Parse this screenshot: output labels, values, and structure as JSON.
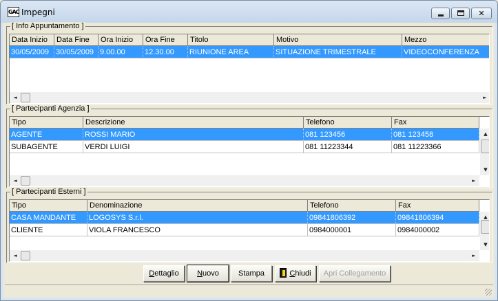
{
  "window": {
    "title": "Impegni",
    "app_icon_text": "GAC",
    "controls": {
      "minimize": "minimize-icon",
      "maximize": "maximize-icon",
      "close": "close-icon",
      "close_glyph": "✕"
    }
  },
  "appuntamento": {
    "caption": "[ Info Appuntamento ]",
    "columns": [
      "Data Inizio",
      "Data Fine",
      "Ora Inizio",
      "Ora Fine",
      "Titolo",
      "Motivo",
      "Mezzo"
    ],
    "rows": [
      [
        "30/05/2009",
        "30/05/2009",
        "9.00.00",
        "12.30.00",
        "RIUNIONE AREA",
        "SITUAZIONE TRIMESTRALE",
        "VIDEOCONFERENZA"
      ]
    ],
    "selected_row": 0
  },
  "agenzia": {
    "caption": "[ Partecipanti Agenzia ]",
    "columns": [
      "Tipo",
      "Descrizione",
      "Telefono",
      "Fax"
    ],
    "rows": [
      [
        "AGENTE",
        "ROSSI MARIO",
        "081 123456",
        "081 123458"
      ],
      [
        "SUBAGENTE",
        "VERDI LUIGI",
        "081 11223344",
        "081 11223366"
      ]
    ],
    "selected_row": 0
  },
  "esterni": {
    "caption": "[ Partecipanti Esterni ]",
    "columns": [
      "Tipo",
      "Denominazione",
      "Telefono",
      "Fax"
    ],
    "rows": [
      [
        "CASA MANDANTE",
        "LOGOSYS S.r.l.",
        "09841806392",
        "09841806394"
      ],
      [
        "CLIENTE",
        "VIOLA FRANCESCO",
        "0984000001",
        "0984000002"
      ]
    ],
    "selected_row": 0
  },
  "buttons": {
    "dettaglio": {
      "mnemonic": "D",
      "rest": "ettaglio"
    },
    "nuovo": {
      "mnemonic": "N",
      "rest": "uovo"
    },
    "stampa": {
      "label": "Stampa"
    },
    "chiudi": {
      "mnemonic": "C",
      "rest": "hiudi",
      "icon": "door-exit-icon"
    },
    "apri": {
      "label": "Apri Collegamento",
      "disabled": true
    }
  },
  "scroll_arrows": {
    "left": "◄",
    "right": "►",
    "up": "▲",
    "down": "▼"
  },
  "colors": {
    "selection": "#3399ff",
    "window_bg": "#ece9d8"
  }
}
